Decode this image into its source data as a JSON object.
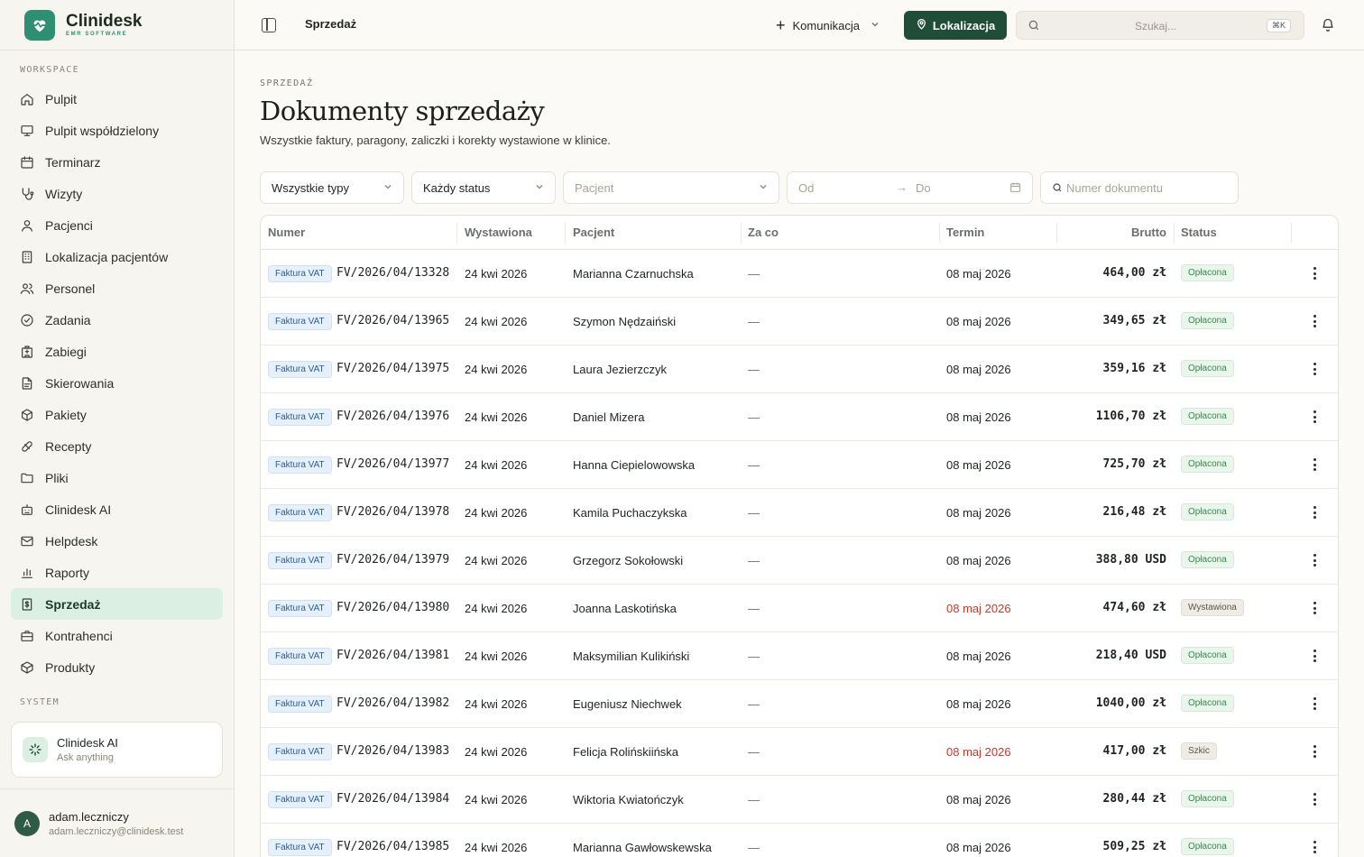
{
  "brand": {
    "name": "Clinidesk",
    "sub": "EMR SOFTWARE"
  },
  "sidebar": {
    "workspace_label": "WORKSPACE",
    "system_label": "SYSTEM",
    "items": [
      {
        "label": "Pulpit",
        "icon": "home-icon"
      },
      {
        "label": "Pulpit współdzielony",
        "icon": "monitor-icon"
      },
      {
        "label": "Terminarz",
        "icon": "calendar-icon"
      },
      {
        "label": "Wizyty",
        "icon": "stethoscope-icon"
      },
      {
        "label": "Pacjenci",
        "icon": "user-icon"
      },
      {
        "label": "Lokalizacja pacjentów",
        "icon": "building-icon"
      },
      {
        "label": "Personel",
        "icon": "users-icon"
      },
      {
        "label": "Zadania",
        "icon": "check-circle-icon"
      },
      {
        "label": "Zabiegi",
        "icon": "hospital-icon"
      },
      {
        "label": "Skierowania",
        "icon": "document-icon"
      },
      {
        "label": "Pakiety",
        "icon": "package-icon"
      },
      {
        "label": "Recepty",
        "icon": "pill-icon"
      },
      {
        "label": "Pliki",
        "icon": "folder-icon"
      },
      {
        "label": "Clinidesk AI",
        "icon": "bot-icon"
      },
      {
        "label": "Helpdesk",
        "icon": "mail-icon"
      },
      {
        "label": "Raporty",
        "icon": "bar-chart-icon"
      },
      {
        "label": "Sprzedaż",
        "icon": "receipt-icon",
        "active": true
      },
      {
        "label": "Kontrahenci",
        "icon": "briefcase-icon"
      },
      {
        "label": "Produkty",
        "icon": "box-icon"
      }
    ],
    "ai_card": {
      "title": "Clinidesk AI",
      "subtitle": "Ask anything"
    },
    "user": {
      "initial": "A",
      "name": "adam.leczniczy",
      "email": "adam.leczniczy@clinidesk.test"
    }
  },
  "topbar": {
    "breadcrumb": "Sprzedaż",
    "komunikacja_label": "Komunikacja",
    "lokalizacja_label": "Lokalizacja",
    "search_placeholder": "Szukaj...",
    "search_shortcut": "⌘K"
  },
  "page": {
    "eyebrow": "SPRZEDAŻ",
    "title": "Dokumenty sprzedaży",
    "subtitle": "Wszystkie faktury, paragony, zaliczki i korekty wystawione w klinice."
  },
  "filters": {
    "type_value": "Wszystkie typy",
    "status_value": "Każdy status",
    "patient_placeholder": "Pacjent",
    "date_from_placeholder": "Od",
    "date_to_placeholder": "Do",
    "number_placeholder": "Numer dokumentu"
  },
  "table": {
    "columns": [
      "Numer",
      "Wystawiona",
      "Pacjent",
      "Za co",
      "Termin",
      "Brutto",
      "Status"
    ],
    "rows": [
      {
        "type": "Faktura VAT",
        "number": "FV/2026/04/13328",
        "issued": "24 kwi 2026",
        "patient": "Marianna Czarnuchska",
        "for": "—",
        "due": "08 maj 2026",
        "overdue": false,
        "amount": "464,00 zł",
        "status": "Opłacona",
        "status_kind": "paid"
      },
      {
        "type": "Faktura VAT",
        "number": "FV/2026/04/13965",
        "issued": "24 kwi 2026",
        "patient": "Szymon Nędzaiński",
        "for": "—",
        "due": "08 maj 2026",
        "overdue": false,
        "amount": "349,65 zł",
        "status": "Opłacona",
        "status_kind": "paid"
      },
      {
        "type": "Faktura VAT",
        "number": "FV/2026/04/13975",
        "issued": "24 kwi 2026",
        "patient": "Laura Jezierzczyk",
        "for": "—",
        "due": "08 maj 2026",
        "overdue": false,
        "amount": "359,16 zł",
        "status": "Opłacona",
        "status_kind": "paid"
      },
      {
        "type": "Faktura VAT",
        "number": "FV/2026/04/13976",
        "issued": "24 kwi 2026",
        "patient": "Daniel Mizera",
        "for": "—",
        "due": "08 maj 2026",
        "overdue": false,
        "amount": "1106,70 zł",
        "status": "Opłacona",
        "status_kind": "paid"
      },
      {
        "type": "Faktura VAT",
        "number": "FV/2026/04/13977",
        "issued": "24 kwi 2026",
        "patient": "Hanna Ciepielowowska",
        "for": "—",
        "due": "08 maj 2026",
        "overdue": false,
        "amount": "725,70 zł",
        "status": "Opłacona",
        "status_kind": "paid"
      },
      {
        "type": "Faktura VAT",
        "number": "FV/2026/04/13978",
        "issued": "24 kwi 2026",
        "patient": "Kamila Puchaczykska",
        "for": "—",
        "due": "08 maj 2026",
        "overdue": false,
        "amount": "216,48 zł",
        "status": "Opłacona",
        "status_kind": "paid"
      },
      {
        "type": "Faktura VAT",
        "number": "FV/2026/04/13979",
        "issued": "24 kwi 2026",
        "patient": "Grzegorz Sokołowski",
        "for": "—",
        "due": "08 maj 2026",
        "overdue": false,
        "amount": "388,80 USD",
        "status": "Opłacona",
        "status_kind": "paid"
      },
      {
        "type": "Faktura VAT",
        "number": "FV/2026/04/13980",
        "issued": "24 kwi 2026",
        "patient": "Joanna Laskotińska",
        "for": "—",
        "due": "08 maj 2026",
        "overdue": true,
        "amount": "474,60 zł",
        "status": "Wystawiona",
        "status_kind": "issued"
      },
      {
        "type": "Faktura VAT",
        "number": "FV/2026/04/13981",
        "issued": "24 kwi 2026",
        "patient": "Maksymilian Kulikiński",
        "for": "—",
        "due": "08 maj 2026",
        "overdue": false,
        "amount": "218,40 USD",
        "status": "Opłacona",
        "status_kind": "paid"
      },
      {
        "type": "Faktura VAT",
        "number": "FV/2026/04/13982",
        "issued": "24 kwi 2026",
        "patient": "Eugeniusz Niechwek",
        "for": "—",
        "due": "08 maj 2026",
        "overdue": false,
        "amount": "1040,00 zł",
        "status": "Opłacona",
        "status_kind": "paid"
      },
      {
        "type": "Faktura VAT",
        "number": "FV/2026/04/13983",
        "issued": "24 kwi 2026",
        "patient": "Felicja Rolińskiińska",
        "for": "—",
        "due": "08 maj 2026",
        "overdue": true,
        "amount": "417,00 zł",
        "status": "Szkic",
        "status_kind": "draft"
      },
      {
        "type": "Faktura VAT",
        "number": "FV/2026/04/13984",
        "issued": "24 kwi 2026",
        "patient": "Wiktoria Kwiatończyk",
        "for": "—",
        "due": "08 maj 2026",
        "overdue": false,
        "amount": "280,44 zł",
        "status": "Opłacona",
        "status_kind": "paid"
      },
      {
        "type": "Faktura VAT",
        "number": "FV/2026/04/13985",
        "issued": "24 kwi 2026",
        "patient": "Marianna Gawłowskewska",
        "for": "—",
        "due": "08 maj 2026",
        "overdue": false,
        "amount": "509,25 zł",
        "status": "Opłacona",
        "status_kind": "paid"
      }
    ]
  }
}
